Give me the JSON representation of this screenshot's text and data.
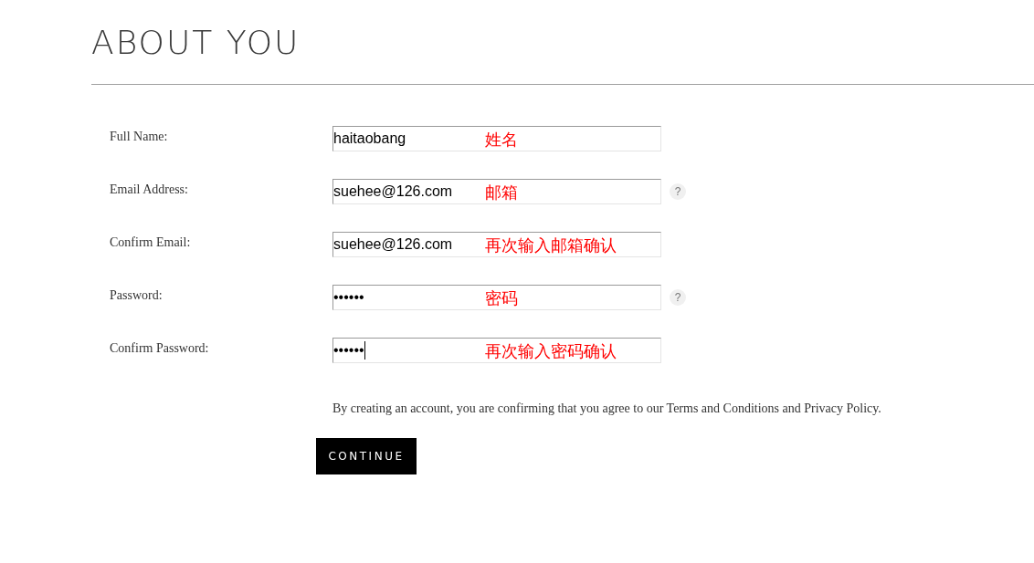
{
  "heading": "ABOUT YOU",
  "fields": [
    {
      "label": "Full Name:",
      "value": "haitaobang",
      "annotation": "姓名",
      "help": false,
      "focused": false
    },
    {
      "label": "Email Address:",
      "value": "suehee@126.com",
      "annotation": "邮箱",
      "help": true,
      "help_text": "?",
      "focused": false
    },
    {
      "label": "Confirm Email:",
      "value": "suehee@126.com",
      "annotation": "再次输入邮箱确认",
      "help": false,
      "focused": false
    },
    {
      "label": "Password:",
      "value": "••••••",
      "annotation": "密码",
      "help": true,
      "help_text": "?",
      "focused": false
    },
    {
      "label": "Confirm Password:",
      "value": "••••••",
      "annotation": "再次输入密码确认",
      "help": false,
      "focused": true
    }
  ],
  "terms": "By creating an account, you are confirming that you agree to our Terms and Conditions and Privacy Policy.",
  "button": "CONTINUE"
}
